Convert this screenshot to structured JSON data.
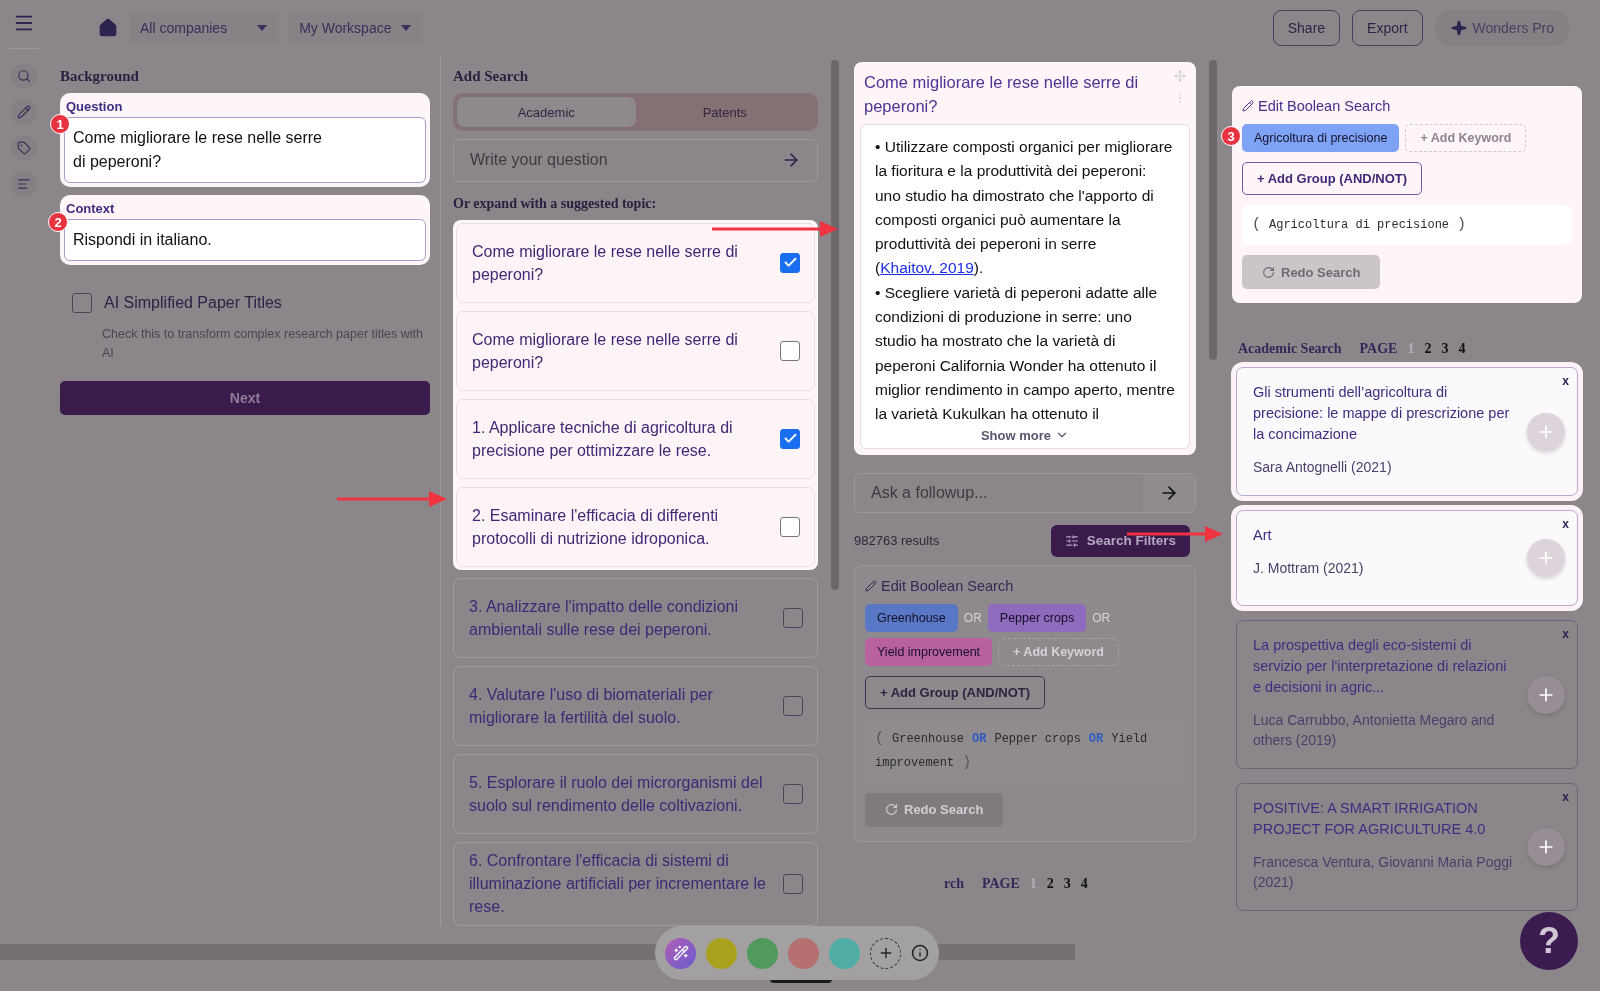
{
  "topbar": {
    "companies": "All companies",
    "workspace": "My Workspace",
    "buttons": [
      "Share",
      "Export"
    ],
    "pro": "Wonders Pro"
  },
  "background": {
    "title": "Background",
    "fields": [
      {
        "label": "Question",
        "value": "Come migliorare le rese nelle serre di peperoni?",
        "step": "1"
      },
      {
        "label": "Context",
        "value": "Rispondi in italiano.",
        "step": "2"
      }
    ],
    "ai_titles": {
      "label": "AI Simplified Paper Titles",
      "checked": false,
      "hint": "Check this to transform complex research paper titles with AI"
    },
    "next": "Next"
  },
  "add_search": {
    "title": "Add Search",
    "tabs": [
      {
        "label": "Academic",
        "selected": true
      },
      {
        "label": "Patents",
        "selected": false
      }
    ],
    "question_placeholder": "Write your question",
    "suggest_heading": "Or expand with a suggested topic:",
    "topics": [
      {
        "text": "Come migliorare le rese nelle serre di peperoni?",
        "checked": true,
        "highlighted": true
      },
      {
        "text": "Come migliorare le rese nelle serre di peperoni?",
        "checked": false,
        "highlighted": true
      },
      {
        "text": "1. Applicare tecniche di agricoltura di precisione per ottimizzare le rese.",
        "checked": true,
        "highlighted": true
      },
      {
        "text": "2. Esaminare l'efficacia di differenti protocolli di nutrizione idroponica.",
        "checked": false,
        "highlighted": true
      },
      {
        "text": "3. Analizzare l'impatto delle condizioni ambientali sulle rese dei peperoni.",
        "checked": false,
        "highlighted": false
      },
      {
        "text": "4. Valutare l'uso di biomateriali per migliorare la fertilità del suolo.",
        "checked": false,
        "highlighted": false
      },
      {
        "text": "5. Esplorare il ruolo dei microrganismi del suolo sul rendimento delle coltivazioni.",
        "checked": false,
        "highlighted": false
      },
      {
        "text": "6. Confrontare l'efficacia di sistemi di illuminazione artificiali per incrementare le rese.",
        "checked": false,
        "highlighted": false
      }
    ]
  },
  "answer": {
    "title": "Come migliorare le rese nelle serre di peperoni?",
    "bullets": [
      {
        "text": "• Utilizzare composti organici per migliorare la fioritura e la produttività dei peperoni: uno studio ha dimostrato che l'apporto di composti organici può aumentare la produttività dei peperoni in serre (",
        "link": "Khaitov, 2019",
        "after": ")."
      },
      {
        "text": "• Scegliere varietà di peperoni adatte alle condizioni di produzione in serre: uno studio ha mostrato che la varietà di peperoni California Wonder ha ottenuto il miglior rendimento in campo aperto, mentre la varietà Kukulkan ha ottenuto il"
      }
    ],
    "show_more": "Show more",
    "followup_placeholder": "Ask a followup...",
    "results": "982763 results",
    "filters": "Search Filters",
    "boolean": {
      "title": "Edit Boolean Search",
      "keywords": [
        {
          "label": "Greenhouse",
          "color": "#5877c4",
          "connector": "OR"
        },
        {
          "label": "Pepper crops",
          "color": "#8e6bbd",
          "connector": "OR"
        },
        {
          "label": "Yield improvement",
          "color": "#b9609f"
        }
      ],
      "add_keyword": "+ Add Keyword",
      "add_group": "+ Add Group (AND/NOT)",
      "query": [
        {
          "text": "(",
          "kind": "paren"
        },
        {
          "text": "Greenhouse",
          "kind": "term"
        },
        {
          "text": "OR",
          "kind": "operator"
        },
        {
          "text": "Pepper crops",
          "kind": "term"
        },
        {
          "text": "OR",
          "kind": "operator"
        },
        {
          "text": "Yield improvement",
          "kind": "term"
        },
        {
          "text": ")",
          "kind": "paren"
        }
      ],
      "redo": "Redo Search"
    },
    "pager": {
      "title": "rch",
      "page": "PAGE",
      "pages": [
        {
          "label": "1",
          "selected": true
        },
        {
          "label": "2",
          "selected": false
        },
        {
          "label": "3",
          "selected": false
        },
        {
          "label": "4",
          "selected": false
        }
      ]
    }
  },
  "right": {
    "boolean": {
      "title": "Edit Boolean Search",
      "step": "3",
      "keywords": [
        {
          "label": "Agricoltura di precisione",
          "color": "#7ea3f6"
        }
      ],
      "add_keyword": "+ Add Keyword",
      "add_group": "+ Add Group (AND/NOT)",
      "query": [
        {
          "text": "(",
          "kind": "paren"
        },
        {
          "text": "Agricoltura di precisione",
          "kind": "term"
        },
        {
          "text": ")",
          "kind": "paren"
        }
      ],
      "redo": "Redo Search"
    },
    "pager": {
      "title": "Academic Search",
      "page": "PAGE",
      "pages": [
        {
          "label": "1",
          "selected": true
        },
        {
          "label": "2",
          "selected": false
        },
        {
          "label": "3",
          "selected": false
        },
        {
          "label": "4",
          "selected": false
        }
      ]
    },
    "papers": [
      {
        "title": "Gli strumenti dell’agricoltura di precisione: le mappe di prescrizione per la concimazione",
        "authors": "Sara Antognelli (2021)",
        "close": "x",
        "highlighted": true
      },
      {
        "title": "Art",
        "authors": "J. Mottram (2021)",
        "close": "x",
        "highlighted": true
      },
      {
        "title": "La prospettiva degli eco-sistemi di servizio per l'interpretazione di relazioni e decisioni in agric...",
        "authors": "Luca Carrubbo, Antonietta Megaro and others (2019)",
        "close": "x",
        "highlighted": false
      },
      {
        "title": "POSITIVE: A SMART IRRIGATION PROJECT FOR AGRICULTURE 4.0",
        "authors": "Francesca Ventura, Giovanni Maria Poggi (2021)",
        "close": "x",
        "highlighted": false
      }
    ]
  },
  "palette": {
    "colors": [
      {
        "color": "#a9a21c"
      },
      {
        "color": "#4f9a5c"
      },
      {
        "color": "#b5706f"
      },
      {
        "color": "#4fada6"
      }
    ]
  },
  "help": "?"
}
